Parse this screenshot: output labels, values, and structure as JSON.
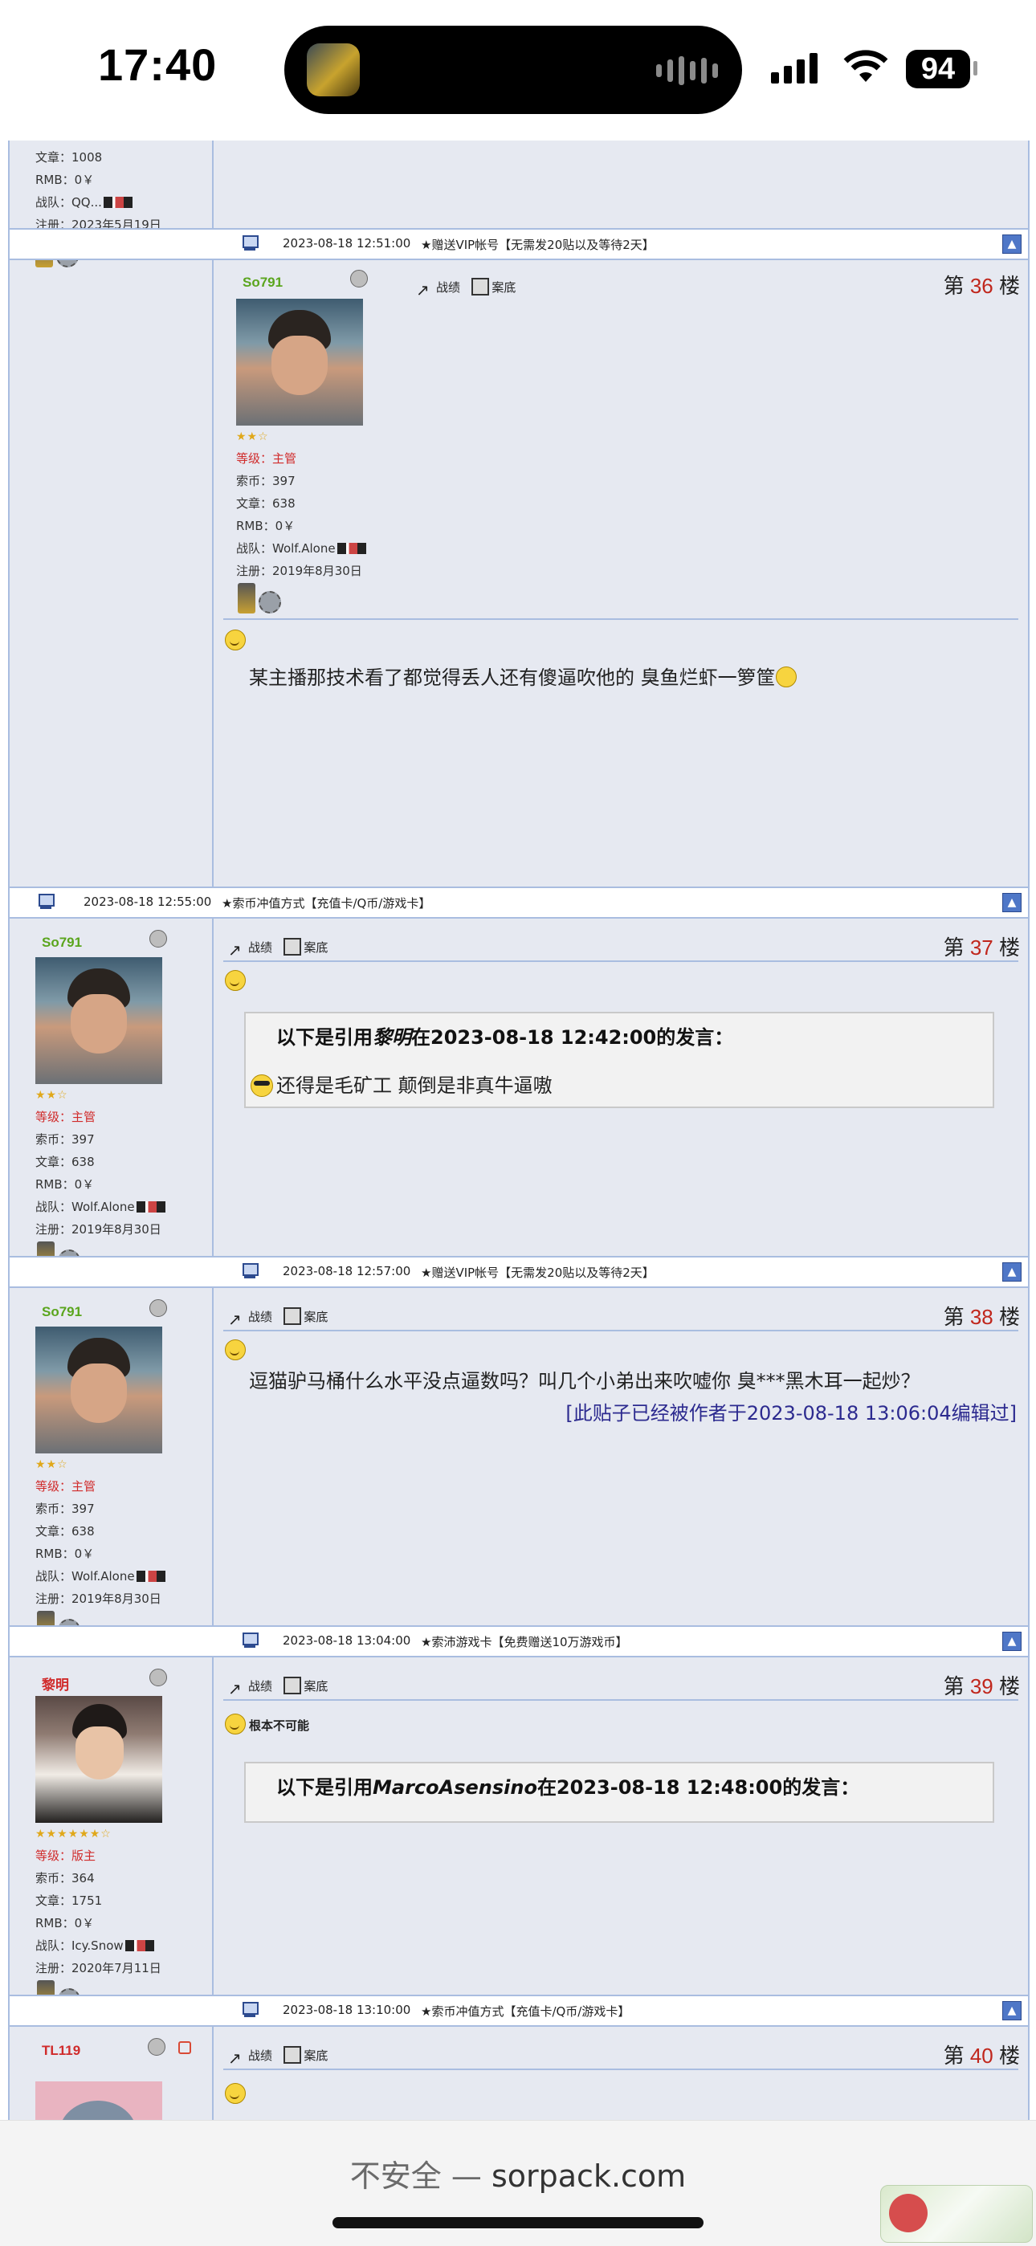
{
  "status_bar": {
    "time": "17:40",
    "battery": "94"
  },
  "post_prev": {
    "stats": [
      "文章：1008",
      "RMB：0￥",
      "战队：QQ...",
      "注册：2023年5月19日"
    ],
    "strip_time": "2023-08-18 12:51:00",
    "strip_ad": "★赠送VIP帐号【无需发20贴以及等待2天】"
  },
  "toolbar": {
    "stats": "战绩",
    "profile": "案底"
  },
  "posts": [
    {
      "username": "So791",
      "level": "等级：主管",
      "stats": [
        "索币：397",
        "文章：638",
        "RMB：0￥",
        "战队：Wolf.Alone",
        "注册：2019年8月30日"
      ],
      "floor_prefix": "第 ",
      "floor_num": "36",
      "floor_suffix": " 楼",
      "text": "某主播那技术看了都觉得丢人还有傻逼吹他的 臭鱼烂虾一箩筐",
      "strip_time": "2023-08-18 12:55:00",
      "strip_ad": "★索币冲值方式【充值卡/Q币/游戏卡】"
    },
    {
      "username": "So791",
      "level": "等级：主管",
      "stats": [
        "索币：397",
        "文章：638",
        "RMB：0￥",
        "战队：Wolf.Alone",
        "注册：2019年8月30日"
      ],
      "floor_prefix": "第 ",
      "floor_num": "37",
      "floor_suffix": " 楼",
      "quote_pre": "以下是引用",
      "quote_author": "黎明",
      "quote_post": "在2023-08-18 12:42:00的发言：",
      "quote_text": "还得是毛矿工 颠倒是非真牛逼嗷",
      "strip_time": "2023-08-18 12:57:00",
      "strip_ad": "★赠送VIP帐号【无需发20贴以及等待2天】"
    },
    {
      "username": "So791",
      "level": "等级：主管",
      "stats": [
        "索币：397",
        "文章：638",
        "RMB：0￥",
        "战队：Wolf.Alone",
        "注册：2019年8月30日"
      ],
      "floor_prefix": "第 ",
      "floor_num": "38",
      "floor_suffix": " 楼",
      "text": "逗猫驴马桶什么水平没点逼数吗？叫几个小弟出来吹嘘你 臭***黑木耳一起炒？",
      "edit_note": "[此贴子已经被作者于2023-08-18 13:06:04编辑过]",
      "strip_time": "2023-08-18 13:04:00",
      "strip_ad": "★索沛游戏卡【免费赠送10万游戏币】"
    },
    {
      "username": "黎明",
      "level": "等级：版主",
      "stats": [
        "索币：364",
        "文章：1751",
        "RMB：0￥",
        "战队：Icy.Snow",
        "注册：2020年7月11日"
      ],
      "floor_prefix": "第 ",
      "floor_num": "39",
      "floor_suffix": " 楼",
      "mood": "根本不可能",
      "quote_pre": "以下是引用",
      "quote_author": "MarcoAsensino",
      "quote_post": "在2023-08-18 12:48:00的发言：",
      "strip_time": "2023-08-18 13:10:00",
      "strip_ad": "★索币冲值方式【充值卡/Q币/游戏卡】"
    },
    {
      "username": "TL119",
      "floor_prefix": "第 ",
      "floor_num": "40",
      "floor_suffix": " 楼"
    }
  ],
  "safari": {
    "not_secure": "不安全 — ",
    "domain": "sorpack.com"
  },
  "colors": {
    "accent_border": "#a9bde0",
    "floor_red": "#c0261c",
    "username_green": "#5aa51d",
    "level_red": "#d02b2b"
  }
}
